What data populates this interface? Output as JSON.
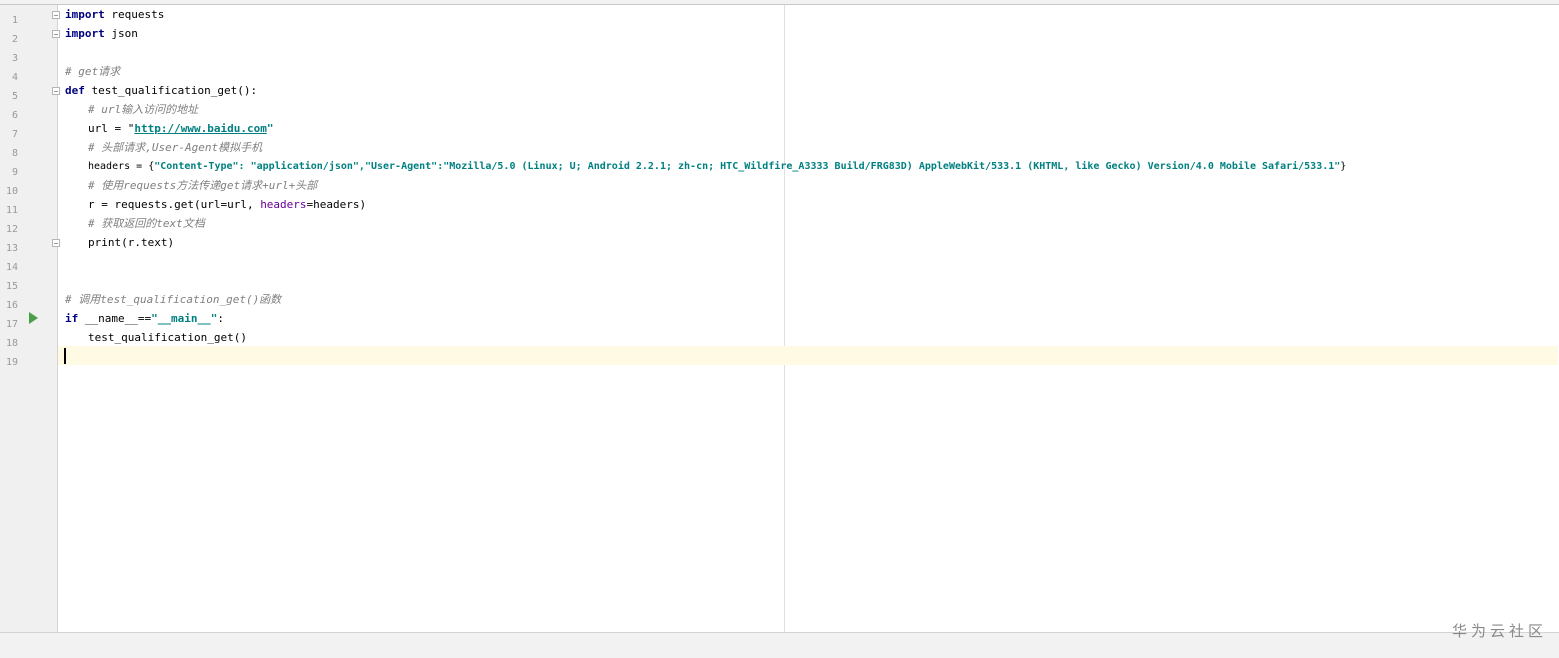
{
  "gutter": {
    "line_numbers": [
      "1",
      "2",
      "3",
      "4",
      "5",
      "6",
      "7",
      "8",
      "9",
      "10",
      "11",
      "12",
      "13",
      "14",
      "15",
      "16",
      "17",
      "18",
      "19"
    ]
  },
  "code": {
    "l1": {
      "kw": "import",
      "rest": " requests"
    },
    "l2": {
      "kw": "import",
      "rest": " json"
    },
    "l4": {
      "comment": "# get请求"
    },
    "l5": {
      "kw": "def",
      "rest": " test_qualification_get():"
    },
    "l6": {
      "comment": "# url输入访问的地址"
    },
    "l7": {
      "pre": "url = \"",
      "link": "http://www.baidu.com",
      "post": "\""
    },
    "l8": {
      "comment": "# 头部请求,User-Agent模拟手机"
    },
    "l9": {
      "pre": "headers = {",
      "str": "\"Content-Type\": \"application/json\",\"User-Agent\":\"Mozilla/5.0 (Linux; U; Android 2.2.1; zh-cn; HTC_Wildfire_A3333 Build/FRG83D) AppleWebKit/533.1 (KHTML, like Gecko) Version/4.0 Mobile Safari/533.1\"",
      "post": "}"
    },
    "l10": {
      "comment": "# 使用requests方法传递get请求+url+头部"
    },
    "l11": {
      "pre": "r = requests.get(url=url, ",
      "param": "headers",
      "post": "=headers)"
    },
    "l12": {
      "comment": "# 获取返回的text文档"
    },
    "l13": {
      "pre": "print(r.text)"
    },
    "l16": {
      "comment": "# 调用test_qualification_get()函数"
    },
    "l17": {
      "kw": "if",
      "pre": " __name__==",
      "str": "\"__main__\"",
      "post": ":"
    },
    "l18": {
      "pre": "test_qualification_get()"
    }
  },
  "watermark": "华为云社区",
  "colors": {
    "keyword": "#000080",
    "string": "#008080",
    "comment": "#808080",
    "param": "#660099",
    "caret_line": "#fffae3",
    "run_icon": "#4a9e4a"
  },
  "icons": {
    "fold": "fold-marker-icon",
    "run": "run-triangle-icon"
  }
}
